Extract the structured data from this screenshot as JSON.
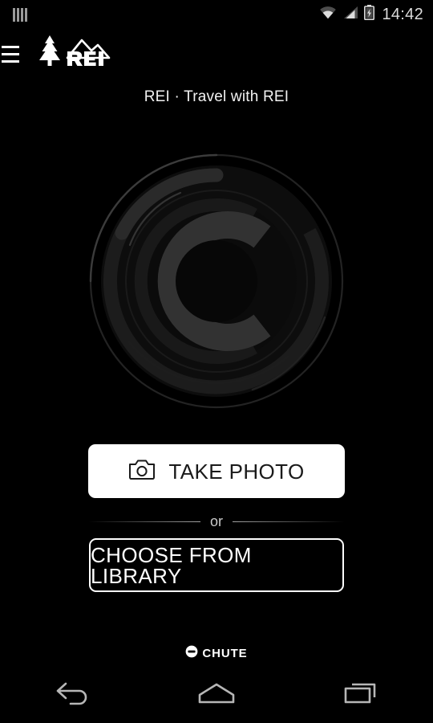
{
  "status_bar": {
    "notification_icon": "notification-bars-icon",
    "wifi_icon": "wifi-icon",
    "signal_icon": "cellular-signal-icon",
    "battery_icon": "battery-charging-icon",
    "time": "14:42"
  },
  "app_bar": {
    "menu_icon": "hamburger-menu-icon",
    "logo_alt": "REI",
    "logo_icon": "rei-mountain-tree-logo"
  },
  "header": {
    "subtitle": "REI · Travel with REI"
  },
  "hero": {
    "graphic": "camera-lens-icon"
  },
  "actions": {
    "take_photo_label": "TAKE PHOTO",
    "take_photo_icon": "camera-icon",
    "divider_label": "or",
    "choose_library_label": "CHOOSE FROM LIBRARY"
  },
  "footer": {
    "brand": "CHUTE",
    "brand_icon": "chute-logo-icon"
  },
  "nav_bar": {
    "back": "back-icon",
    "home": "home-icon",
    "recents": "recents-icon"
  },
  "colors": {
    "background": "#000000",
    "primary_text": "#ffffff",
    "button_fill": "#ffffff",
    "button_text_dark": "#1a1a1a",
    "muted_text": "#c9c9c9",
    "status_icon": "#dcdcdc",
    "nav_icon": "#b6b6b6",
    "lens_dark": "#141414",
    "lens_mid": "#1e1e1e",
    "lens_light": "#2e2e2e"
  }
}
